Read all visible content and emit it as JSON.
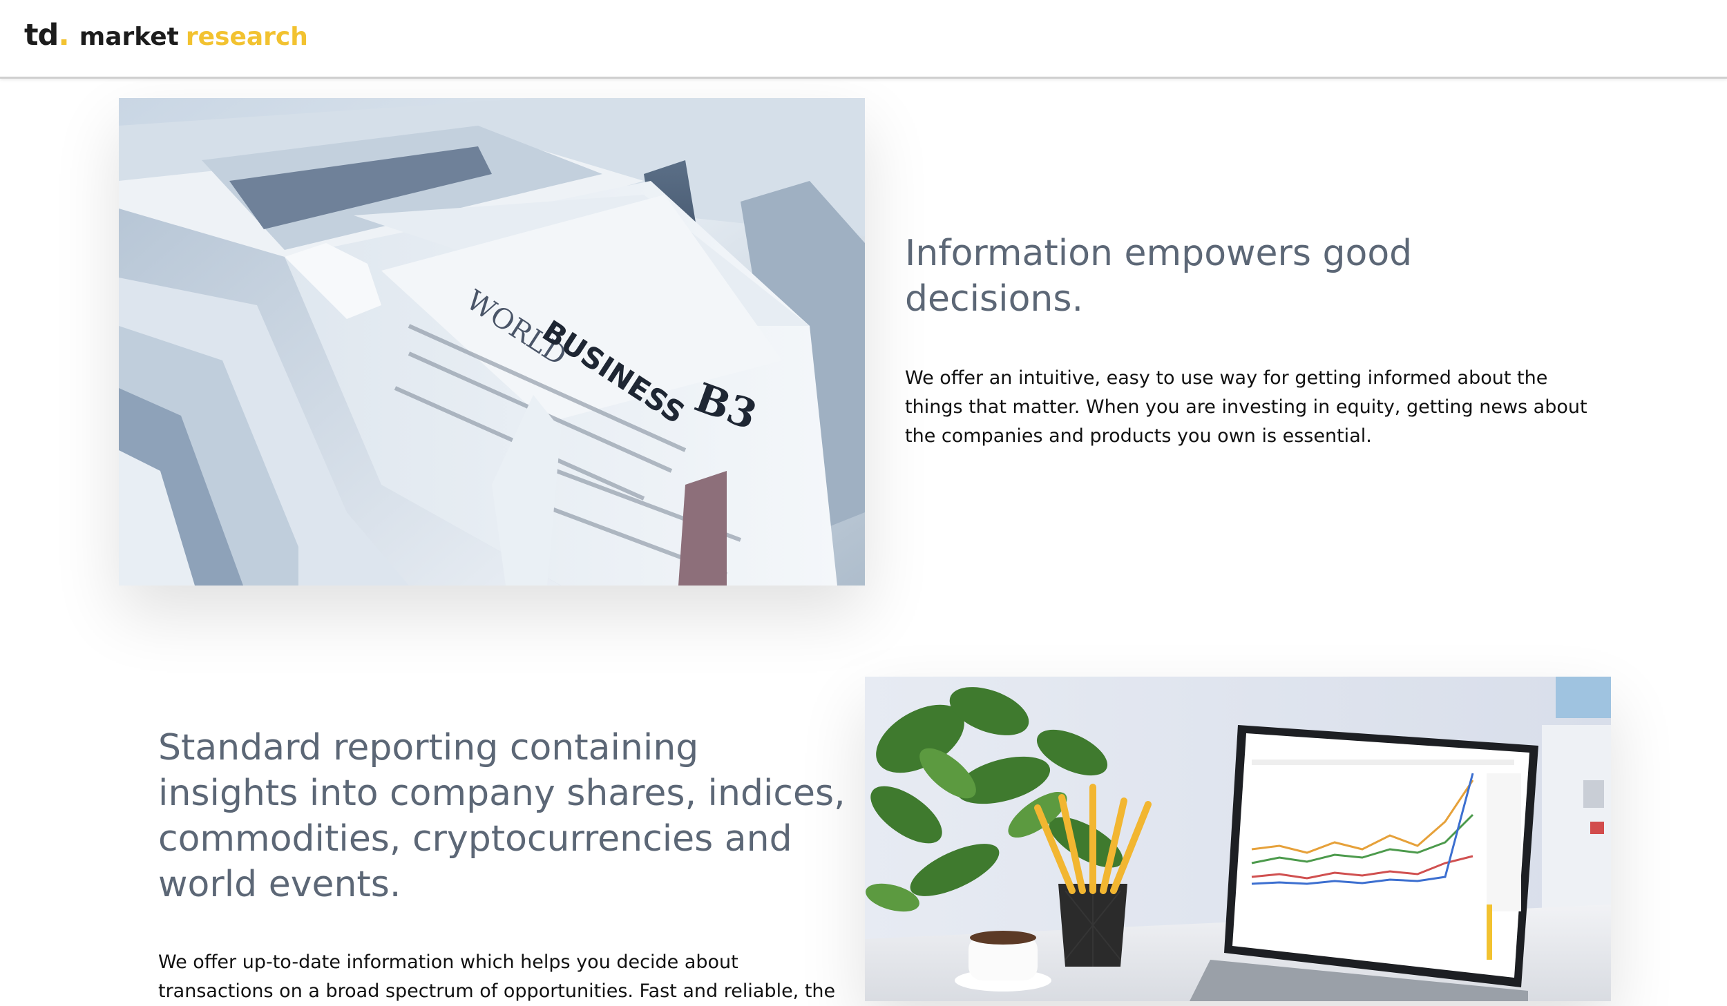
{
  "header": {
    "logo_td": "td",
    "logo_dot": ".",
    "logo_market": "market",
    "logo_research": "research",
    "colors": {
      "accent": "#f2c230",
      "text": "#1c1c1c"
    }
  },
  "sections": [
    {
      "image": "newspapers-photo",
      "heading": "Information empowers good decisions.",
      "body": "We offer an intuitive, easy to use way for getting informed about the things that matter. When you are investing in equity, getting news about the companies and products you own is essential.",
      "image_text": {
        "world": "WORLD",
        "business": "BUSINESS",
        "page": "B3"
      }
    },
    {
      "image": "laptop-desk-photo",
      "heading": "Standard reporting containing insights into company shares, indices, commodities, cryptocurrencies and world events.",
      "body": "We offer up-to-date information which helps you decide about transactions on a broad spectrum of opportunities. Fast and reliable, the"
    }
  ],
  "colors": {
    "heading": "#5c6776",
    "body": "#111111"
  }
}
